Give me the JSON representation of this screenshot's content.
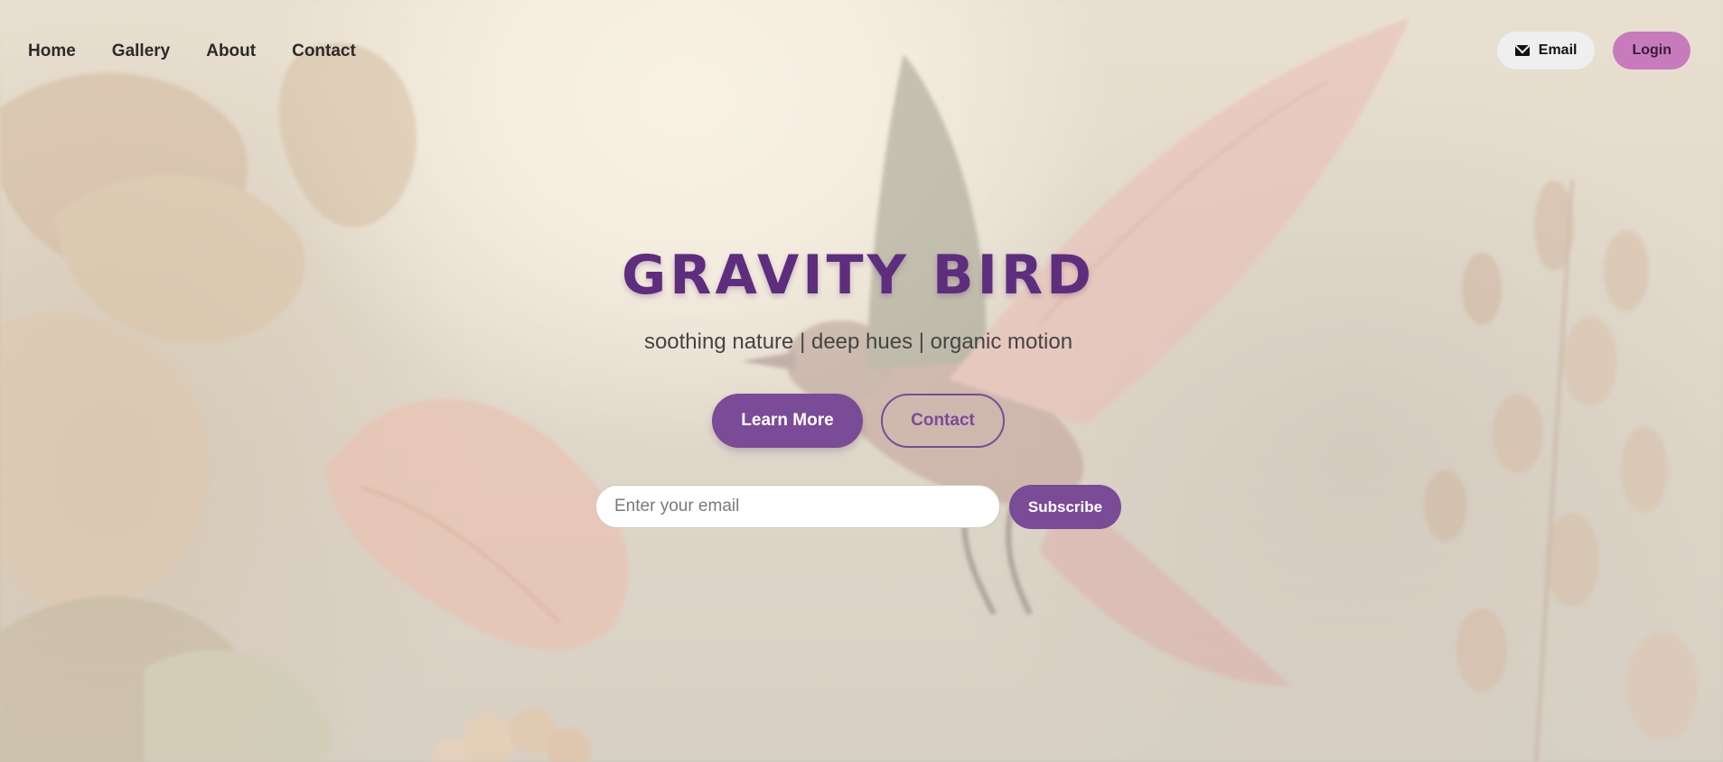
{
  "nav": {
    "items": [
      {
        "label": "Home"
      },
      {
        "label": "Gallery"
      },
      {
        "label": "About"
      },
      {
        "label": "Contact"
      }
    ]
  },
  "top_actions": {
    "email_label": "Email",
    "email_icon": "envelope-icon",
    "login_label": "Login"
  },
  "hero": {
    "title": "GRAVITY BIRD",
    "subtitle": "soothing nature | deep hues | organic motion",
    "learn_more_label": "Learn More",
    "contact_label": "Contact"
  },
  "subscribe": {
    "placeholder": "Enter your email",
    "value": "",
    "button_label": "Subscribe"
  },
  "colors": {
    "brand_purple": "#5e2d7e",
    "button_purple": "#7a4b97",
    "login_pink": "#c77bbd"
  }
}
